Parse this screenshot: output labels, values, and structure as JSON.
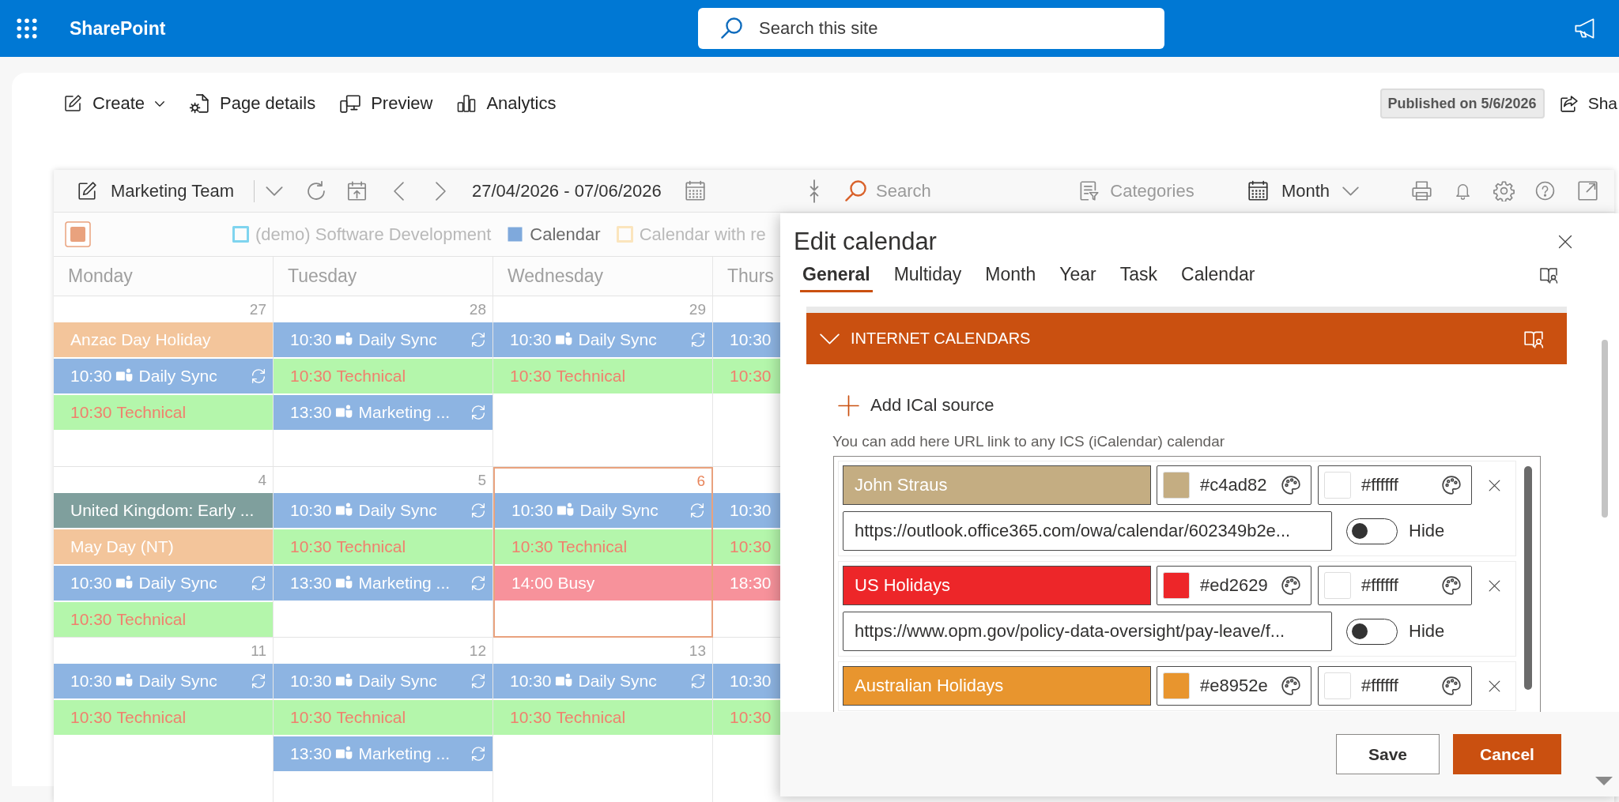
{
  "top_bar": {
    "app_name": "SharePoint",
    "search": {
      "placeholder": "Search this site"
    }
  },
  "command_bar": {
    "items": [
      {
        "label": "Create",
        "kind": "dropdown"
      },
      {
        "label": "Page details",
        "kind": "button"
      },
      {
        "label": "Preview",
        "kind": "button"
      },
      {
        "label": "Analytics",
        "kind": "button"
      }
    ],
    "status": "Published on 5/6/2026",
    "share": {
      "label": "Sha"
    }
  },
  "calendar": {
    "toolbar": {
      "title": "Marketing Team",
      "date_range": "27/04/2026 - 07/06/2026",
      "search": {
        "placeholder": "Search"
      },
      "categories": "Categories",
      "view": "Month"
    },
    "legend": [
      {
        "label": "(demo) Software Development",
        "color": "#7fd4ef",
        "checked": false
      },
      {
        "label": "Calendar",
        "color": "#7fa9dc",
        "checked": true
      },
      {
        "label": "Calendar with re",
        "color": "#fbe5bd",
        "checked": false
      }
    ],
    "day_headers": [
      "Monday",
      "Tuesday",
      "Wednesday",
      "Thurs"
    ],
    "weeks": [
      {
        "days": [
          {
            "date": "27",
            "today": false,
            "events": [
              {
                "title": "Anzac Day Holiday",
                "kind": "all_day",
                "color": "#f3c59b",
                "accent_text": false,
                "recurring": false
              },
              {
                "time": "10:30",
                "title": "Daily Sync",
                "kind": "teams",
                "color": "#8db4e2",
                "accent_text": false,
                "recurring": true
              },
              {
                "time": "10:30",
                "title": "Technical",
                "kind": "timed",
                "color": "#b4f6ab",
                "accent_text": true,
                "recurring": false
              }
            ]
          },
          {
            "date": "28",
            "today": false,
            "events": [
              {
                "time": "10:30",
                "title": "Daily Sync",
                "kind": "teams",
                "color": "#8db4e2",
                "accent_text": false,
                "recurring": true
              },
              {
                "time": "10:30",
                "title": "Technical",
                "kind": "timed",
                "color": "#b4f6ab",
                "accent_text": true,
                "recurring": false
              },
              {
                "time": "13:30",
                "title": "Marketing ...",
                "kind": "teams",
                "color": "#8db4e2",
                "accent_text": false,
                "recurring": true
              }
            ]
          },
          {
            "date": "29",
            "today": false,
            "events": [
              {
                "time": "10:30",
                "title": "Daily Sync",
                "kind": "teams",
                "color": "#8db4e2",
                "accent_text": false,
                "recurring": true
              },
              {
                "time": "10:30",
                "title": "Technical",
                "kind": "timed",
                "color": "#b4f6ab",
                "accent_text": true,
                "recurring": false
              }
            ]
          },
          {
            "today": false,
            "events": [
              {
                "time": "10:30",
                "kind": "timed",
                "color": "#8db4e2",
                "accent_text": false,
                "recurring": false
              },
              {
                "time": "10:30",
                "kind": "timed",
                "color": "#b4f6ab",
                "accent_text": true,
                "recurring": false
              }
            ]
          }
        ]
      },
      {
        "days": [
          {
            "date": "4",
            "today": false,
            "events": [
              {
                "title": "United Kingdom: Early ...",
                "kind": "all_day",
                "color": "#7f9f9d",
                "accent_text": false,
                "recurring": false
              },
              {
                "title": "May Day (NT)",
                "kind": "all_day",
                "color": "#f3c59b",
                "accent_text": false,
                "recurring": false
              },
              {
                "time": "10:30",
                "title": "Daily Sync",
                "kind": "teams",
                "color": "#8db4e2",
                "accent_text": false,
                "recurring": true
              },
              {
                "time": "10:30",
                "title": "Technical",
                "kind": "timed",
                "color": "#b4f6ab",
                "accent_text": true,
                "recurring": false
              }
            ]
          },
          {
            "date": "5",
            "today": false,
            "events": [
              {
                "time": "10:30",
                "title": "Daily Sync",
                "kind": "teams",
                "color": "#8db4e2",
                "accent_text": false,
                "recurring": true
              },
              {
                "time": "10:30",
                "title": "Technical",
                "kind": "timed",
                "color": "#b4f6ab",
                "accent_text": true,
                "recurring": false
              },
              {
                "time": "13:30",
                "title": "Marketing ...",
                "kind": "teams",
                "color": "#8db4e2",
                "accent_text": false,
                "recurring": true
              }
            ]
          },
          {
            "date": "6",
            "today": true,
            "events": [
              {
                "time": "10:30",
                "title": "Daily Sync",
                "kind": "teams",
                "color": "#8db4e2",
                "accent_text": false,
                "recurring": true
              },
              {
                "time": "10:30",
                "title": "Technical",
                "kind": "timed",
                "color": "#b4f6ab",
                "accent_text": true,
                "recurring": false
              },
              {
                "time": "14:00",
                "title": "Busy",
                "kind": "timed",
                "color": "#f7929b",
                "accent_text": false,
                "recurring": false
              }
            ]
          },
          {
            "today": false,
            "events": [
              {
                "time": "10:30",
                "kind": "timed",
                "color": "#8db4e2",
                "accent_text": false,
                "recurring": false
              },
              {
                "time": "10:30",
                "kind": "timed",
                "color": "#b4f6ab",
                "accent_text": true,
                "recurring": false
              },
              {
                "time": "18:30",
                "kind": "timed",
                "color": "#f7929b",
                "accent_text": false,
                "recurring": false
              }
            ]
          }
        ]
      },
      {
        "days": [
          {
            "date": "11",
            "today": false,
            "events": [
              {
                "time": "10:30",
                "title": "Daily Sync",
                "kind": "teams",
                "color": "#8db4e2",
                "accent_text": false,
                "recurring": true
              },
              {
                "time": "10:30",
                "title": "Technical",
                "kind": "timed",
                "color": "#b4f6ab",
                "accent_text": true,
                "recurring": false
              }
            ]
          },
          {
            "date": "12",
            "today": false,
            "events": [
              {
                "time": "10:30",
                "title": "Daily Sync",
                "kind": "teams",
                "color": "#8db4e2",
                "accent_text": false,
                "recurring": true
              },
              {
                "time": "10:30",
                "title": "Technical",
                "kind": "timed",
                "color": "#b4f6ab",
                "accent_text": true,
                "recurring": false
              },
              {
                "time": "13:30",
                "title": "Marketing ...",
                "kind": "teams",
                "color": "#8db4e2",
                "accent_text": false,
                "recurring": true
              }
            ]
          },
          {
            "date": "13",
            "today": false,
            "events": [
              {
                "time": "10:30",
                "title": "Daily Sync",
                "kind": "teams",
                "color": "#8db4e2",
                "accent_text": false,
                "recurring": true
              },
              {
                "time": "10:30",
                "title": "Technical",
                "kind": "timed",
                "color": "#b4f6ab",
                "accent_text": true,
                "recurring": false
              }
            ]
          },
          {
            "today": false,
            "events": [
              {
                "time": "10:30",
                "kind": "timed",
                "color": "#8db4e2",
                "accent_text": false,
                "recurring": false
              },
              {
                "time": "10:30",
                "kind": "timed",
                "color": "#b4f6ab",
                "accent_text": true,
                "recurring": false
              }
            ]
          }
        ]
      }
    ]
  },
  "edit_panel": {
    "title": "Edit calendar",
    "tabs": [
      {
        "label": "General",
        "selected": true
      },
      {
        "label": "Multiday",
        "selected": false
      },
      {
        "label": "Month",
        "selected": false
      },
      {
        "label": "Year",
        "selected": false
      },
      {
        "label": "Task",
        "selected": false
      },
      {
        "label": "Calendar",
        "selected": false
      }
    ],
    "section": {
      "title": "INTERNET CALENDARS",
      "expanded": true,
      "add_label": "Add ICal source",
      "help": "You can add here URL link to any ICS (iCalendar) calendar",
      "sources": [
        {
          "name": "John Straus",
          "color": "#c4ad82",
          "text_color": "#ffffff",
          "url": "https://outlook.office365.com/owa/calendar/602349b2e...",
          "hidden": false,
          "hide_label": "Hide"
        },
        {
          "name": "US Holidays",
          "color": "#ed2629",
          "text_color": "#ffffff",
          "url": "https://www.opm.gov/policy-data-oversight/pay-leave/f...",
          "hidden": false,
          "hide_label": "Hide"
        },
        {
          "name": "Australian Holidays",
          "color": "#e8952e",
          "text_color": "#ffffff"
        }
      ]
    },
    "buttons": [
      {
        "label": "Save",
        "kind": "secondary"
      },
      {
        "label": "Cancel",
        "kind": "primary"
      }
    ]
  }
}
